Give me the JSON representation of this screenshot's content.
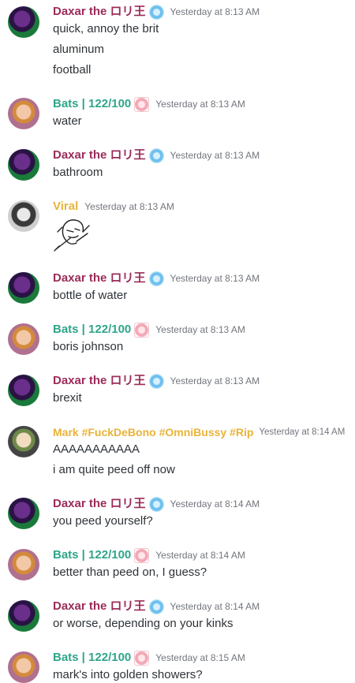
{
  "messages": [
    {
      "author": "Daxar the ロリ王",
      "badge": "blue-badge",
      "timestamp": "Yesterday at 8:13 AM",
      "lines": [
        "quick, annoy the brit",
        "aluminum",
        "football"
      ]
    },
    {
      "author": "Bats | 122/100",
      "badge": "pink-badge",
      "timestamp": "Yesterday at 8:13 AM",
      "lines": [
        "water"
      ]
    },
    {
      "author": "Daxar the ロリ王",
      "badge": "blue-badge",
      "timestamp": "Yesterday at 8:13 AM",
      "lines": [
        "bathroom"
      ]
    },
    {
      "author": "Viral",
      "badge": "",
      "timestamp": "Yesterday at 8:13 AM",
      "lines": [],
      "attachment": "sketch-image"
    },
    {
      "author": "Daxar the ロリ王",
      "badge": "blue-badge",
      "timestamp": "Yesterday at 8:13 AM",
      "lines": [
        "bottle of water"
      ]
    },
    {
      "author": "Bats | 122/100",
      "badge": "pink-badge",
      "timestamp": "Yesterday at 8:13 AM",
      "lines": [
        "boris johnson"
      ]
    },
    {
      "author": "Daxar the ロリ王",
      "badge": "blue-badge",
      "timestamp": "Yesterday at 8:13 AM",
      "lines": [
        "brexit"
      ]
    },
    {
      "author": "Mark #FuckDeBono #OmniBussy #Rip",
      "badge": "",
      "timestamp": "Yesterday at 8:14 AM",
      "lines": [
        "AAAAAAAAAAA",
        "i am quite peed off now"
      ]
    },
    {
      "author": "Daxar the ロリ王",
      "badge": "blue-badge",
      "timestamp": "Yesterday at 8:14 AM",
      "lines": [
        "you peed yourself?"
      ]
    },
    {
      "author": "Bats | 122/100",
      "badge": "pink-badge",
      "timestamp": "Yesterday at 8:14 AM",
      "lines": [
        "better than peed on, I guess?"
      ]
    },
    {
      "author": "Daxar the ロリ王",
      "badge": "blue-badge",
      "timestamp": "Yesterday at 8:14 AM",
      "lines": [
        "or worse, depending on your kinks"
      ]
    },
    {
      "author": "Bats | 122/100",
      "badge": "pink-badge",
      "timestamp": "Yesterday at 8:15 AM",
      "lines": [
        "mark's into golden showers?"
      ]
    }
  ],
  "colors": {
    "daxar": "#9b2c59",
    "bats": "#2fa58a",
    "viral": "#e8b33a",
    "mark": "#e8b33a",
    "timestamp": "#72767d",
    "text": "#2e3338"
  }
}
